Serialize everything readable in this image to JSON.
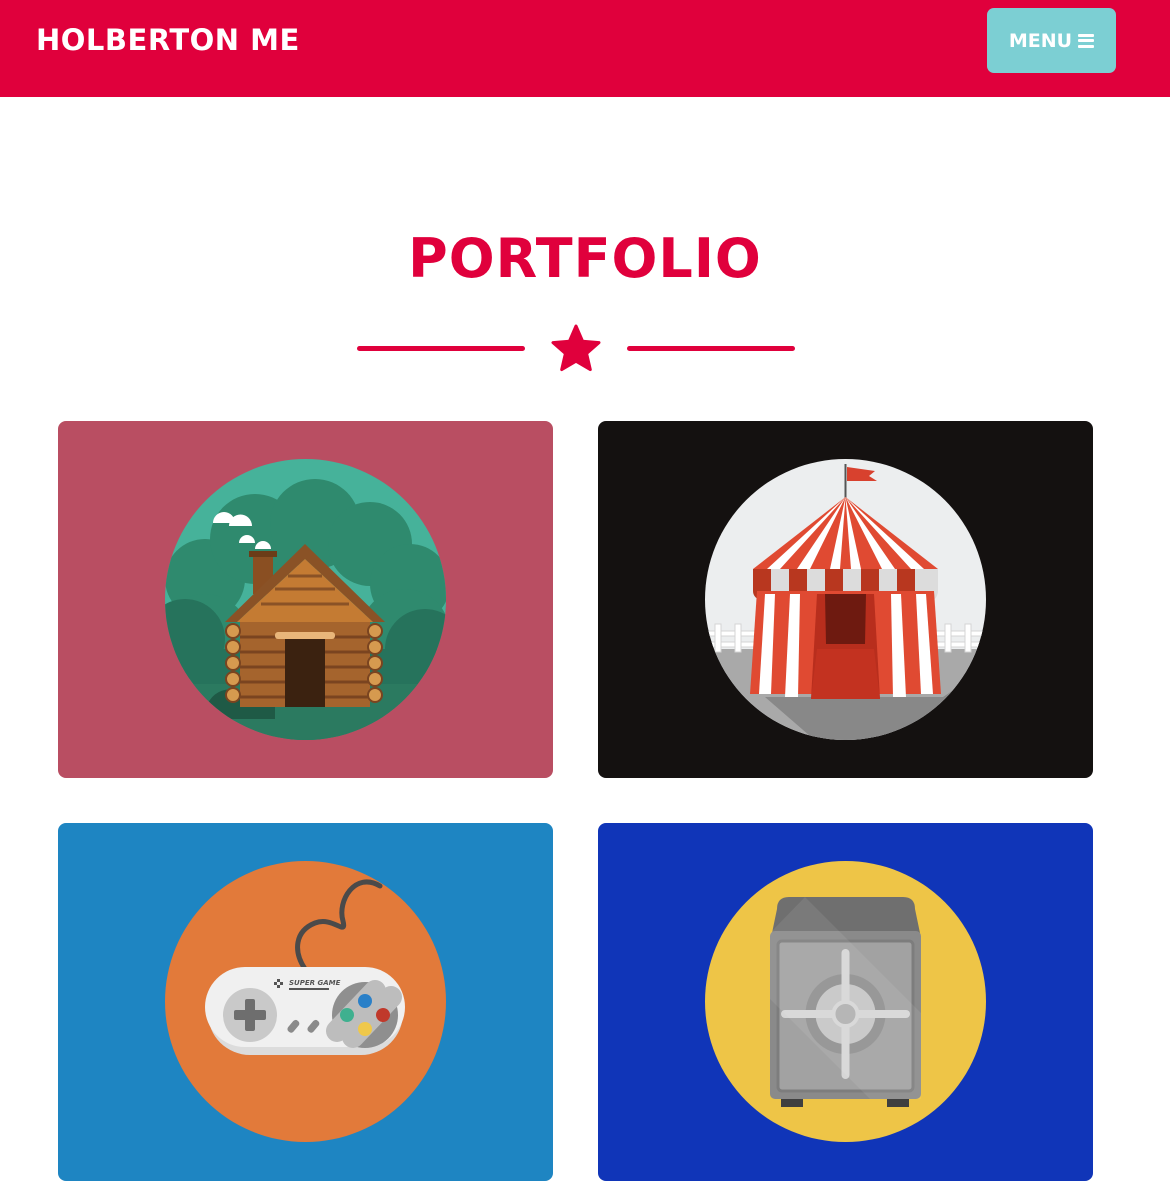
{
  "navbar": {
    "brand": "HOLBERTON ME",
    "menu_label": "MENU",
    "menu_icon": "bars-icon",
    "background": "#e0003c",
    "menu_color": "#7ccfd3"
  },
  "portfolio": {
    "title": "PORTFOLIO",
    "divider_icon": "star-icon",
    "accent": "#e0003c",
    "items": [
      {
        "icon": "log-cabin-icon",
        "background": "#b94e62"
      },
      {
        "icon": "circus-tent-icon",
        "background": "#141110"
      },
      {
        "icon": "game-controller-icon",
        "background": "#1e85c2"
      },
      {
        "icon": "safe-icon",
        "background": "#1035b8"
      }
    ]
  },
  "controller": {
    "brand_text": "SUPER GAME"
  }
}
